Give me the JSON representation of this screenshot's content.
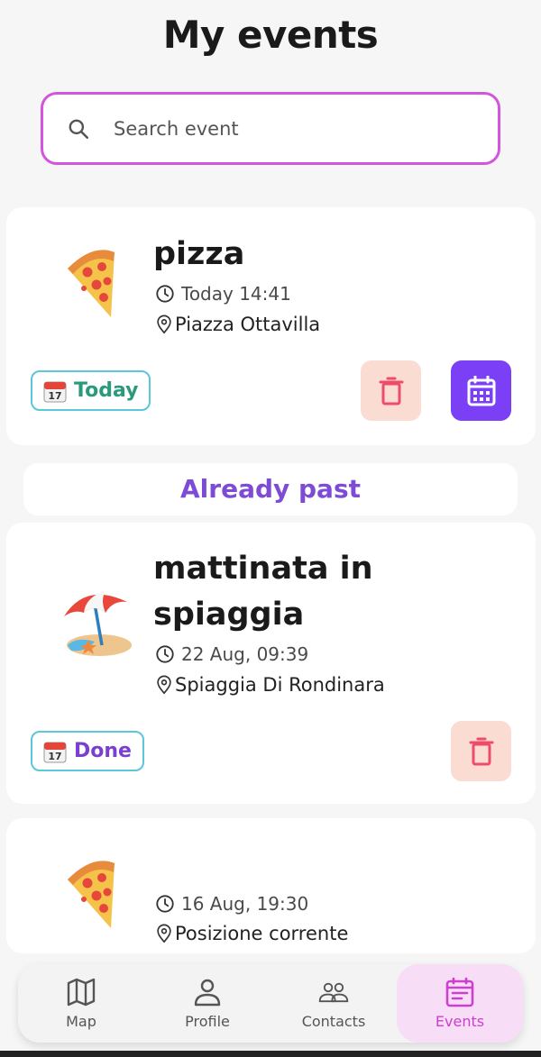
{
  "header": {
    "title": "My events"
  },
  "search": {
    "placeholder": "Search event",
    "value": ""
  },
  "events": [
    {
      "emoji": "pizza",
      "title": "pizza",
      "time": "Today 14:41",
      "location": "Piazza Ottavilla",
      "badge": "Today",
      "badge_color": "#2a9a7c",
      "actions": [
        "delete",
        "calendar"
      ]
    },
    {
      "emoji": "beach-umbrella",
      "title": "mattinata in spiaggia",
      "time": "22 Aug, 09:39",
      "location": "Spiaggia Di Rondinara",
      "badge": "Done",
      "badge_color": "#7b3fcf",
      "actions": [
        "delete"
      ]
    },
    {
      "emoji": "pizza",
      "title": "",
      "time": "16 Aug, 19:30",
      "location": "Posizione corrente"
    }
  ],
  "sections": {
    "past_label": "Already past"
  },
  "colors": {
    "accent": "#d355dd",
    "calendar_button": "#7b3ff5",
    "delete_button_bg": "#fadcd3",
    "delete_icon": "#ef4c6a",
    "past_label": "#7d4bd6",
    "nav_active_bg": "#f7ddf6",
    "nav_active": "#cc3fcf"
  },
  "nav": {
    "items": [
      {
        "label": "Map",
        "icon": "map-icon",
        "active": false
      },
      {
        "label": "Profile",
        "icon": "user-icon",
        "active": false
      },
      {
        "label": "Contacts",
        "icon": "users-icon",
        "active": false
      },
      {
        "label": "Events",
        "icon": "calendar-list-icon",
        "active": true
      }
    ]
  }
}
